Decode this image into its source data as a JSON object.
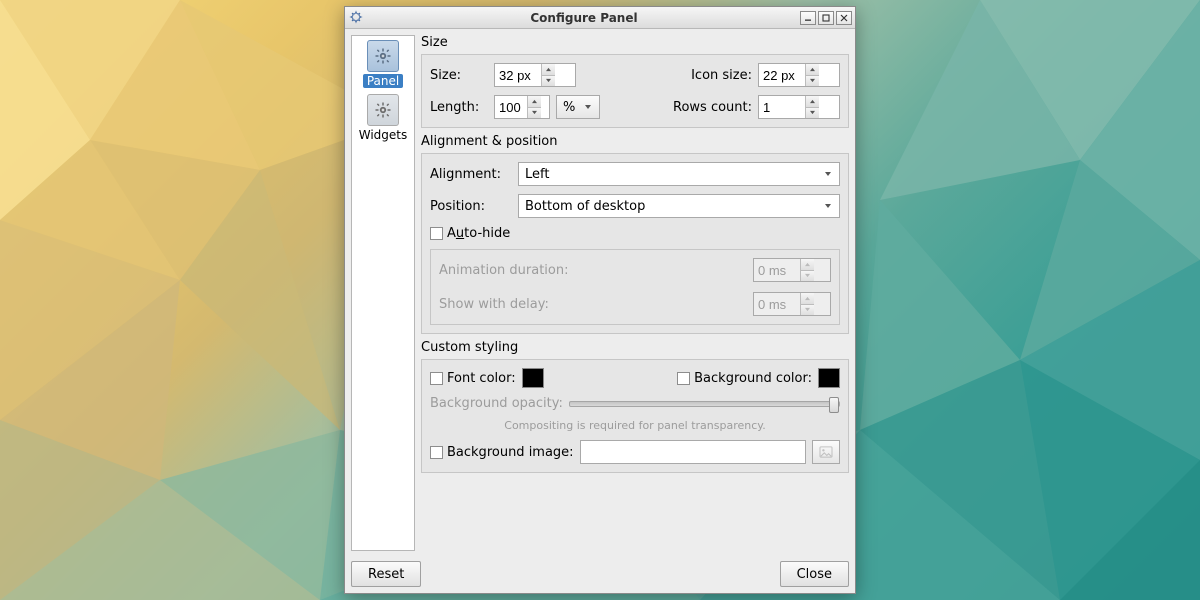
{
  "window": {
    "title": "Configure Panel"
  },
  "categories": {
    "panel": {
      "label": "Panel",
      "selected": true
    },
    "widgets": {
      "label": "Widgets",
      "selected": false
    }
  },
  "size_group": {
    "title": "Size",
    "size_label": "Size:",
    "size_value": "32 px",
    "iconsize_label": "Icon size:",
    "iconsize_value": "22 px",
    "length_label": "Length:",
    "length_value": "100",
    "length_unit": "%",
    "rows_label": "Rows count:",
    "rows_value": "1"
  },
  "align_group": {
    "title": "Alignment & position",
    "alignment_label": "Alignment:",
    "alignment_value": "Left",
    "position_label": "Position:",
    "position_value": "Bottom of desktop",
    "autohide_label_pre": "A",
    "autohide_label_ul": "u",
    "autohide_label_post": "to-hide",
    "anim_label": "Animation duration:",
    "anim_value": "0 ms",
    "delay_label": "Show with delay:",
    "delay_value": "0 ms"
  },
  "style_group": {
    "title": "Custom styling",
    "fontcolor_label": "Font color:",
    "fontcolor_value": "#000000",
    "bgcolor_label": "Background color:",
    "bgcolor_value": "#000000",
    "bgopacity_label": "Background opacity:",
    "bgopacity_value": 100,
    "compositing_hint": "Compositing is required for panel transparency.",
    "bgimage_label": "Background image:",
    "bgimage_value": ""
  },
  "footer": {
    "reset_label": "Reset",
    "close_label": "Close"
  }
}
